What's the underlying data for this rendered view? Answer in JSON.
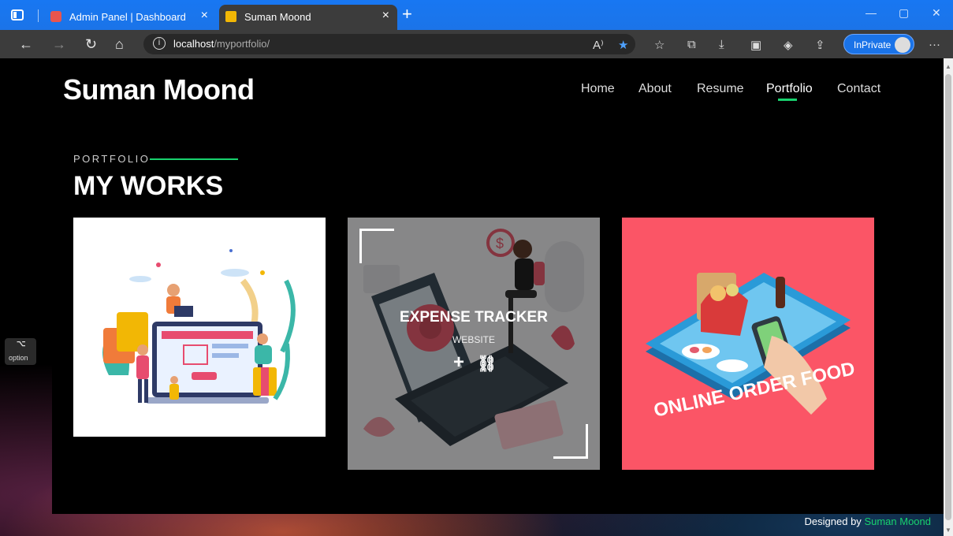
{
  "browser": {
    "tabs": [
      {
        "title": "Admin Panel | Dashboard"
      },
      {
        "title": "Suman Moond"
      }
    ],
    "url_host": "localhost",
    "url_path": "/myportfolio/",
    "inprivate_label": "InPrivate"
  },
  "site": {
    "brand": "Suman Moond",
    "nav": [
      "Home",
      "About",
      "Resume",
      "Portfolio",
      "Contact"
    ],
    "active_nav": "Portfolio"
  },
  "section": {
    "subtitle": "PORTFOLIO",
    "title": "MY WORKS"
  },
  "works": [
    {
      "name": "online-shopping-illustration"
    },
    {
      "name": "expense-tracker",
      "title": "EXPENSE TRACKER",
      "category": "WEBSITE"
    },
    {
      "name": "online-order-food",
      "caption": "ONLINE ORDER FOOD"
    }
  ],
  "keycap": {
    "symbol": "⌥",
    "label": "option"
  },
  "footer": {
    "prefix": "Designed by",
    "author": "Suman Moond"
  },
  "colors": {
    "accent": "#18d26e",
    "tabbar": "#1b74e8",
    "card3_bg": "#fb5566"
  }
}
